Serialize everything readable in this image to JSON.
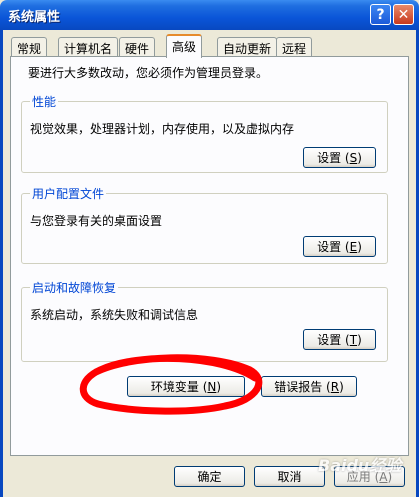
{
  "window": {
    "title": "系统属性"
  },
  "tabs": [
    {
      "label": "常规"
    },
    {
      "label": "计算机名"
    },
    {
      "label": "硬件"
    },
    {
      "label": "高级"
    },
    {
      "label": "自动更新"
    },
    {
      "label": "远程"
    }
  ],
  "note": "要进行大多数改动，您必须作为管理员登录。",
  "groups": {
    "performance": {
      "title": "性能",
      "desc": "视觉效果，处理器计划，内存使用，以及虚拟内存",
      "button": "设置",
      "key": "S"
    },
    "profiles": {
      "title": "用户配置文件",
      "desc": "与您登录有关的桌面设置",
      "button": "设置",
      "key": "E"
    },
    "startup": {
      "title": "启动和故障恢复",
      "desc": "系统启动，系统失败和调试信息",
      "button": "设置",
      "key": "T"
    }
  },
  "buttons": {
    "env": {
      "label": "环境变量",
      "key": "N"
    },
    "error": {
      "label": "错误报告",
      "key": "R"
    },
    "ok": {
      "label": "确定"
    },
    "cancel": {
      "label": "取消"
    },
    "apply": {
      "label": "应用",
      "key": "A"
    }
  },
  "watermark": "Baidu经验",
  "colors": {
    "titlebar": "#0a55d8",
    "group_title": "#0046d5",
    "active_tab_accent": "#e68b2c",
    "annotation": "#ff0000"
  }
}
